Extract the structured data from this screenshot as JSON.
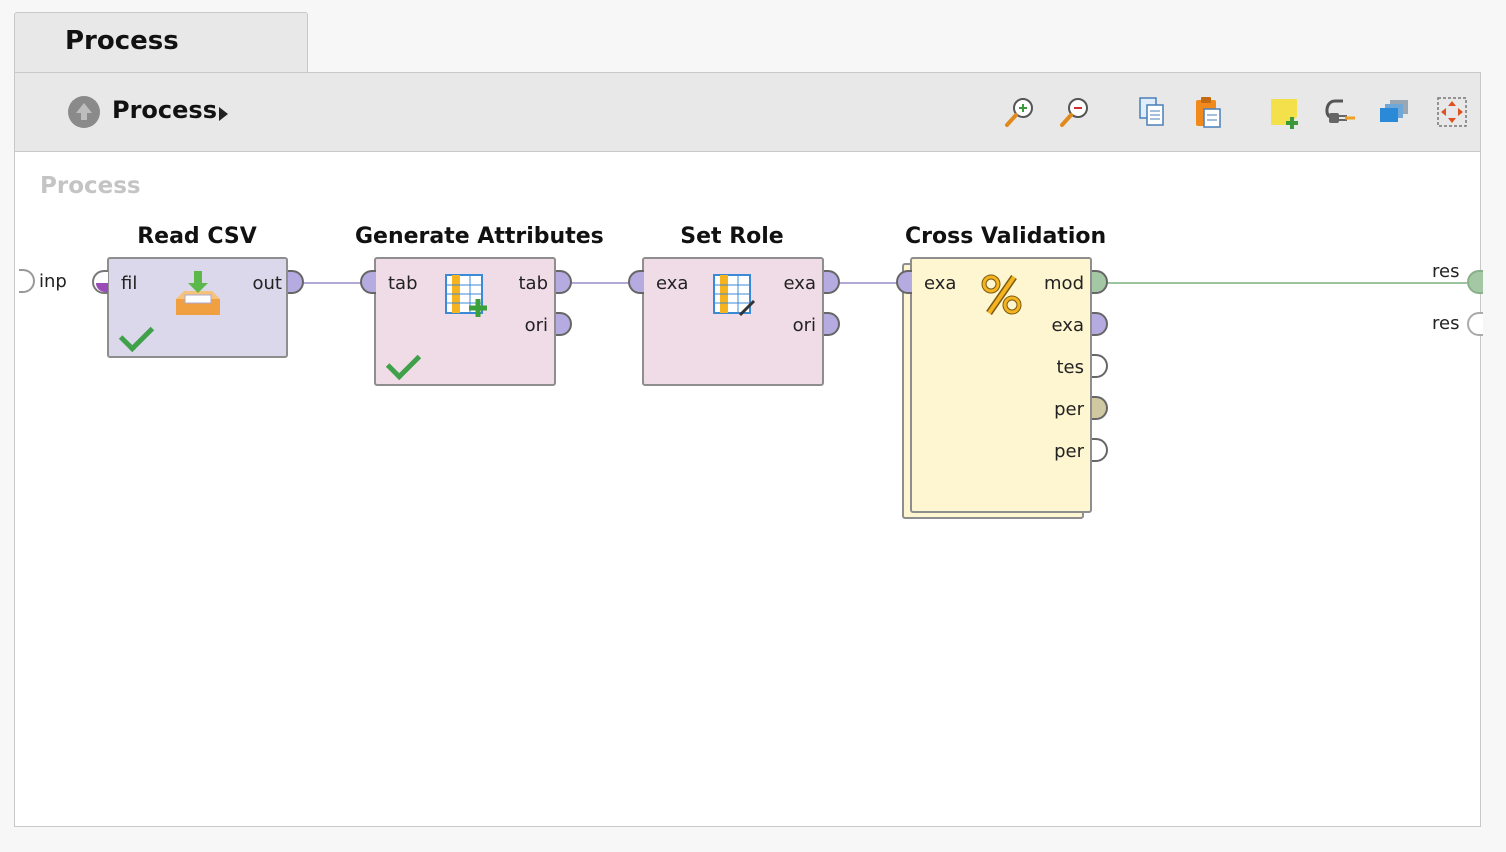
{
  "tab": {
    "label": "Process"
  },
  "breadcrumb": {
    "label": "Process"
  },
  "toolbar": {
    "buttons": [
      "zoom-in-icon",
      "zoom-out-icon",
      "copy-icon",
      "paste-icon",
      "add-note-icon",
      "auto-wire-icon",
      "layers-icon",
      "fit-view-icon"
    ]
  },
  "canvas": {
    "label": "Process"
  },
  "process_ports": {
    "input": "inp",
    "outputs": [
      "res",
      "res"
    ]
  },
  "operators": [
    {
      "title": "Read CSV",
      "inputs": [
        "fil"
      ],
      "outputs": [
        "out"
      ],
      "status": "done",
      "icon": "read-csv-icon",
      "color": "#dcd8ec"
    },
    {
      "title": "Generate Attributes",
      "inputs": [
        "tab"
      ],
      "outputs": [
        "tab",
        "ori"
      ],
      "status": "done",
      "icon": "generate-attributes-icon",
      "color": "#f0dce6"
    },
    {
      "title": "Set Role",
      "inputs": [
        "exa"
      ],
      "outputs": [
        "exa",
        "ori"
      ],
      "status": "none",
      "icon": "set-role-icon",
      "color": "#f0dce6"
    },
    {
      "title": "Cross Validation",
      "inputs": [
        "exa"
      ],
      "outputs": [
        "mod",
        "exa",
        "tes",
        "per",
        "per"
      ],
      "status": "none",
      "icon": "percent-icon",
      "color": "#fdf6d0"
    }
  ],
  "colors": {
    "wire_example": "#b3a9d8",
    "wire_model": "#9cc49e",
    "port_example": "#b5abe0",
    "port_model": "#a3c8a3",
    "port_perf": "#cfc8a0"
  }
}
